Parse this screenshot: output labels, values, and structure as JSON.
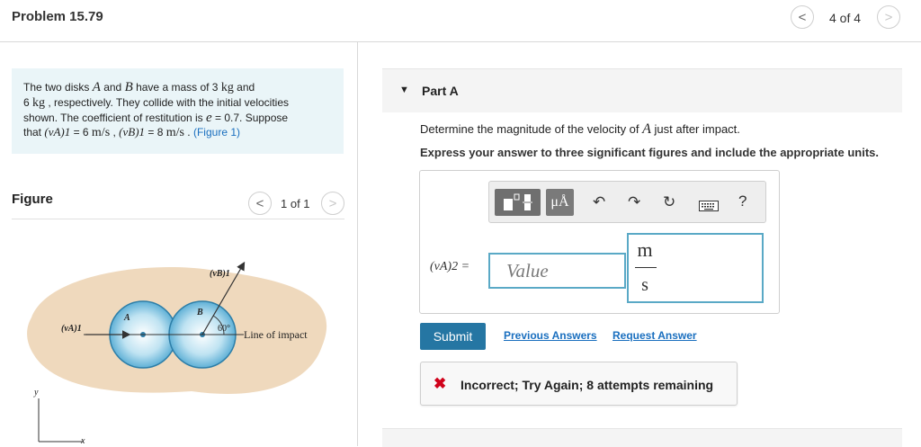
{
  "header": {
    "title": "Problem 15.79",
    "prev_icon": "<",
    "next_icon": ">",
    "page_count": "4 of 4"
  },
  "problem": {
    "t1": "The two disks ",
    "A": "A",
    "t2": " and ",
    "B": "B",
    "t3": " have a mass of 3 ",
    "kg1": "kg",
    "t4": " and",
    "t5": "6 ",
    "kg2": "kg",
    "t6": " , respectively. They collide with the initial velocities",
    "t7": "shown. The coefficient of restitution is ",
    "e": "e",
    "t8": " = 0.7. Suppose",
    "t9": "that ",
    "vA": "(vA)1",
    "t10": " = 6 ",
    "ms1": "m/s",
    "t11": " , ",
    "vB": "(vB)1",
    "t12": " = 8 ",
    "ms2": "m/s",
    "t13": " . ",
    "figure_link": "(Figure 1)"
  },
  "figure": {
    "label": "Figure",
    "count": "1 of 1",
    "prev_icon": "<",
    "next_icon": ">",
    "vB_label": "(vB)1",
    "vA_label": "(vA)1",
    "disk_a": "A",
    "disk_b": "B",
    "angle": "60°",
    "line_of_impact": "Line of impact",
    "axis_y": "y",
    "axis_x": "x"
  },
  "part_a": {
    "caret": "▼",
    "title": "Part A",
    "question_pre": "Determine the magnitude of the velocity of ",
    "question_var": "A",
    "question_post": " just after impact.",
    "instruction": "Express your answer to three significant figures and include the appropriate units.",
    "toolbar": {
      "units_label": "μÅ",
      "undo_icon": "↶",
      "redo_icon": "↷",
      "reset_icon": "↻",
      "keyboard_icon": "⌨",
      "help_icon": "?"
    },
    "var_label": "(vA)2 =",
    "value_placeholder": "Value",
    "unit_numerator": "m",
    "unit_denominator": "s",
    "submit_label": "Submit",
    "previous_answers_label": "Previous Answers",
    "request_answer_label": "Request Answer",
    "feedback_icon": "✖",
    "feedback_text": "Incorrect; Try Again; 8 attempts remaining"
  },
  "colors": {
    "accent": "#2576a3",
    "link": "#1a6fbf",
    "error": "#d0021b",
    "input_border": "#5aa9c6",
    "problem_bg": "#eaf5f8"
  }
}
